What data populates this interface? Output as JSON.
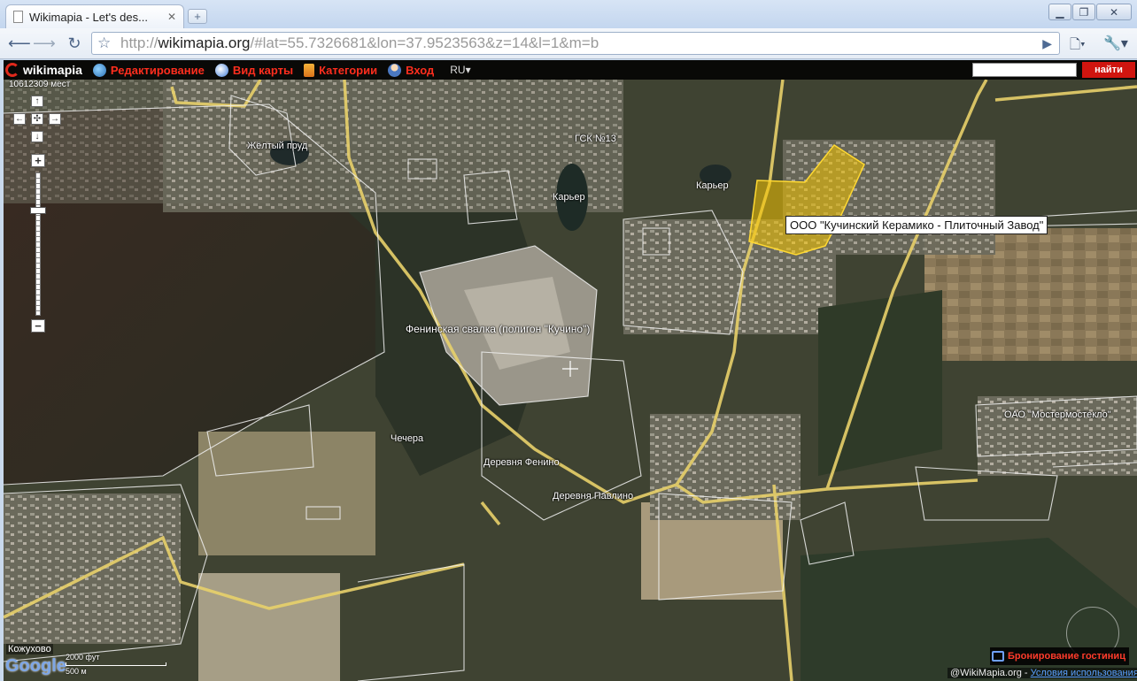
{
  "browser": {
    "tab_title": "Wikimapia - Let's des...",
    "tab_close": "✕",
    "new_tab": "+",
    "url_scheme": "http://",
    "url_host": "wikimapia.org",
    "url_rest": "/#lat=55.7326681&lon=37.9523563&z=14&l=1&m=b",
    "icons": [
      "page-icon",
      "back-arrow-icon",
      "forward-arrow-icon",
      "reload-icon",
      "star-icon",
      "go-icon",
      "page-menu-icon",
      "wrench-icon"
    ]
  },
  "wikimapia": {
    "logo": "wikimapia",
    "menu": {
      "edit": "Редактирование",
      "view": "Вид карты",
      "categories": "Категории",
      "login": "Вход"
    },
    "lang": "RU",
    "search_placeholder": "",
    "find_button": "найти",
    "object_count": "10612309 мест"
  },
  "map": {
    "labels": {
      "yellow_pond": "Жёлтый пруд",
      "gsk": "ГСК №13",
      "quarry_1": "Карьер",
      "quarry_2": "Карьер",
      "landfill": "Фенинская свалка (полигон \"Кучино\")",
      "checher": "Чечера",
      "fenino": "Деревня Фенино",
      "pavlino": "Деревня Павлино",
      "mostermost": "ОАО \"Мостермостекло\"",
      "kozhukhovo": "Кожухово"
    },
    "tooltip": "ООО \"Кучинский Керамико - Плиточный Завод\"",
    "highlight_color": "#f5c400",
    "scale_ft": "2000 фут",
    "scale_m": "500 м",
    "google_logo": "Google",
    "hotel_booking": "Бронирование гостиниц",
    "copyright": "@WikiMapia.org - ",
    "terms": "Условия использования"
  }
}
